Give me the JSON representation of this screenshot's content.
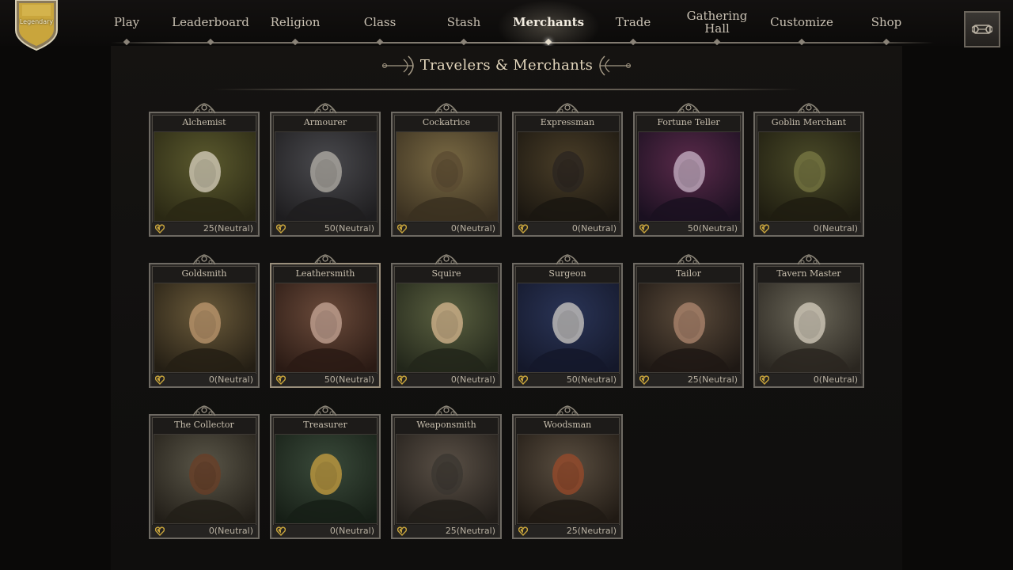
{
  "badge": {
    "label": "Legendary"
  },
  "nav": {
    "items": [
      {
        "label": "Play",
        "active": false
      },
      {
        "label": "Leaderboard",
        "active": false
      },
      {
        "label": "Religion",
        "active": false
      },
      {
        "label": "Class",
        "active": false
      },
      {
        "label": "Stash",
        "active": false
      },
      {
        "label": "Merchants",
        "active": true
      },
      {
        "label": "Trade",
        "active": false
      },
      {
        "label": "Gathering Hall",
        "active": false
      },
      {
        "label": "Customize",
        "active": false
      },
      {
        "label": "Shop",
        "active": false
      }
    ]
  },
  "corner_button": {
    "icon": "scroll-icon"
  },
  "page": {
    "title": "Travelers & Merchants"
  },
  "merchants": [
    {
      "name": "Alchemist",
      "reputation": "25(Neutral)",
      "selected": false
    },
    {
      "name": "Armourer",
      "reputation": "50(Neutral)",
      "selected": false
    },
    {
      "name": "Cockatrice",
      "reputation": "0(Neutral)",
      "selected": false
    },
    {
      "name": "Expressman",
      "reputation": "0(Neutral)",
      "selected": false
    },
    {
      "name": "Fortune Teller",
      "reputation": "50(Neutral)",
      "selected": false
    },
    {
      "name": "Goblin Merchant",
      "reputation": "0(Neutral)",
      "selected": false
    },
    {
      "name": "Goldsmith",
      "reputation": "0(Neutral)",
      "selected": false
    },
    {
      "name": "Leathersmith",
      "reputation": "50(Neutral)",
      "selected": true
    },
    {
      "name": "Squire",
      "reputation": "0(Neutral)",
      "selected": false
    },
    {
      "name": "Surgeon",
      "reputation": "50(Neutral)",
      "selected": false
    },
    {
      "name": "Tailor",
      "reputation": "25(Neutral)",
      "selected": false
    },
    {
      "name": "Tavern Master",
      "reputation": "0(Neutral)",
      "selected": false
    },
    {
      "name": "The Collector",
      "reputation": "0(Neutral)",
      "selected": false
    },
    {
      "name": "Treasurer",
      "reputation": "0(Neutral)",
      "selected": false
    },
    {
      "name": "Weaponsmith",
      "reputation": "25(Neutral)",
      "selected": false
    },
    {
      "name": "Woodsman",
      "reputation": "25(Neutral)",
      "selected": false
    }
  ],
  "colors": {
    "accent_gold": "#c9a53c",
    "frame": "#6e6a63",
    "text": "#c8bfae"
  }
}
